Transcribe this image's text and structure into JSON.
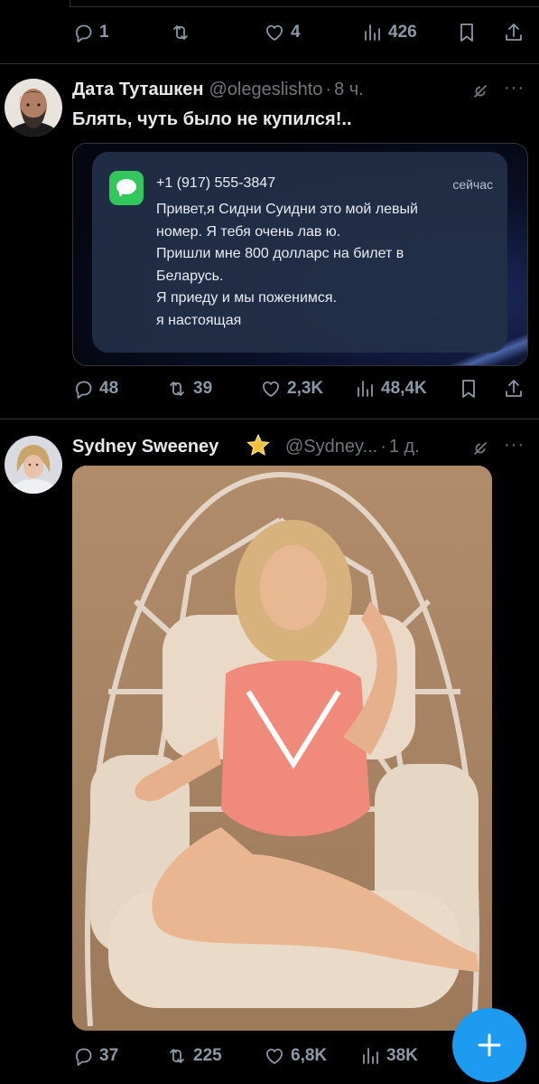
{
  "colors": {
    "background": "#000000",
    "divider": "#2f3336",
    "text": "#e7e9ea",
    "muted": "#71767b",
    "accent": "#1d9bf0",
    "verified": "#f4c13a"
  },
  "top_bar": {
    "reply_count": "1",
    "repost_count": "",
    "like_count": "4",
    "view_count": "426",
    "icons": [
      "reply-icon",
      "repost-icon",
      "like-icon",
      "views-icon",
      "bookmark-icon",
      "share-icon"
    ]
  },
  "tweet1": {
    "author_name": "Дата Туташкен",
    "handle": "@olegeslishto",
    "separator": "·",
    "time": "8 ч.",
    "more": "···",
    "text": "Блять, чуть было не купился!..",
    "notification": {
      "app": "messages",
      "phone": "+1 (917) 555-3847",
      "time": "сейчас",
      "lines": [
        "Привет,я Сидни Суидни это мой левый",
        "номер. Я тебя очень лав ю.",
        "Пришли мне 800 долларс на билет в",
        "Беларусь.",
        "Я приеду и мы поженимся.",
        "я настоящая"
      ]
    },
    "stats": {
      "replies": "48",
      "reposts": "39",
      "likes": "2,3K",
      "views": "48,4K"
    }
  },
  "tweet2": {
    "author_name": "Sydney Sweeney",
    "badge_icon": "star-badge-icon",
    "handle": "@Sydney...",
    "separator": "·",
    "time": "1 д.",
    "more": "···",
    "media": "photo",
    "stats": {
      "replies": "37",
      "reposts": "225",
      "likes": "6,8K",
      "views": "38K"
    }
  },
  "compose_fab": {
    "icon": "plus-icon"
  }
}
